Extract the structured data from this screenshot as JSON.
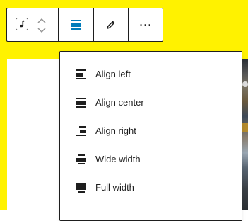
{
  "colors": {
    "background_yellow": "#fff200",
    "accent_blue": "#007cba",
    "text_dark": "#1e1e1e",
    "muted_gray": "#949494"
  },
  "toolbar": {
    "block_type_icon": "audio-music-note-icon",
    "mover_icons": [
      "chevron-up-icon",
      "chevron-down-icon"
    ],
    "align_icon": "align-center-icon",
    "edit_icon": "pencil-icon",
    "more_icon": "more-options-ellipsis-icon",
    "more_label": "⋯"
  },
  "align_menu": {
    "items": [
      {
        "label": "Align left",
        "icon": "align-left-icon"
      },
      {
        "label": "Align center",
        "icon": "align-center-icon"
      },
      {
        "label": "Align right",
        "icon": "align-right-icon"
      },
      {
        "label": "Wide width",
        "icon": "align-wide-icon"
      },
      {
        "label": "Full width",
        "icon": "align-full-width-icon"
      }
    ]
  }
}
